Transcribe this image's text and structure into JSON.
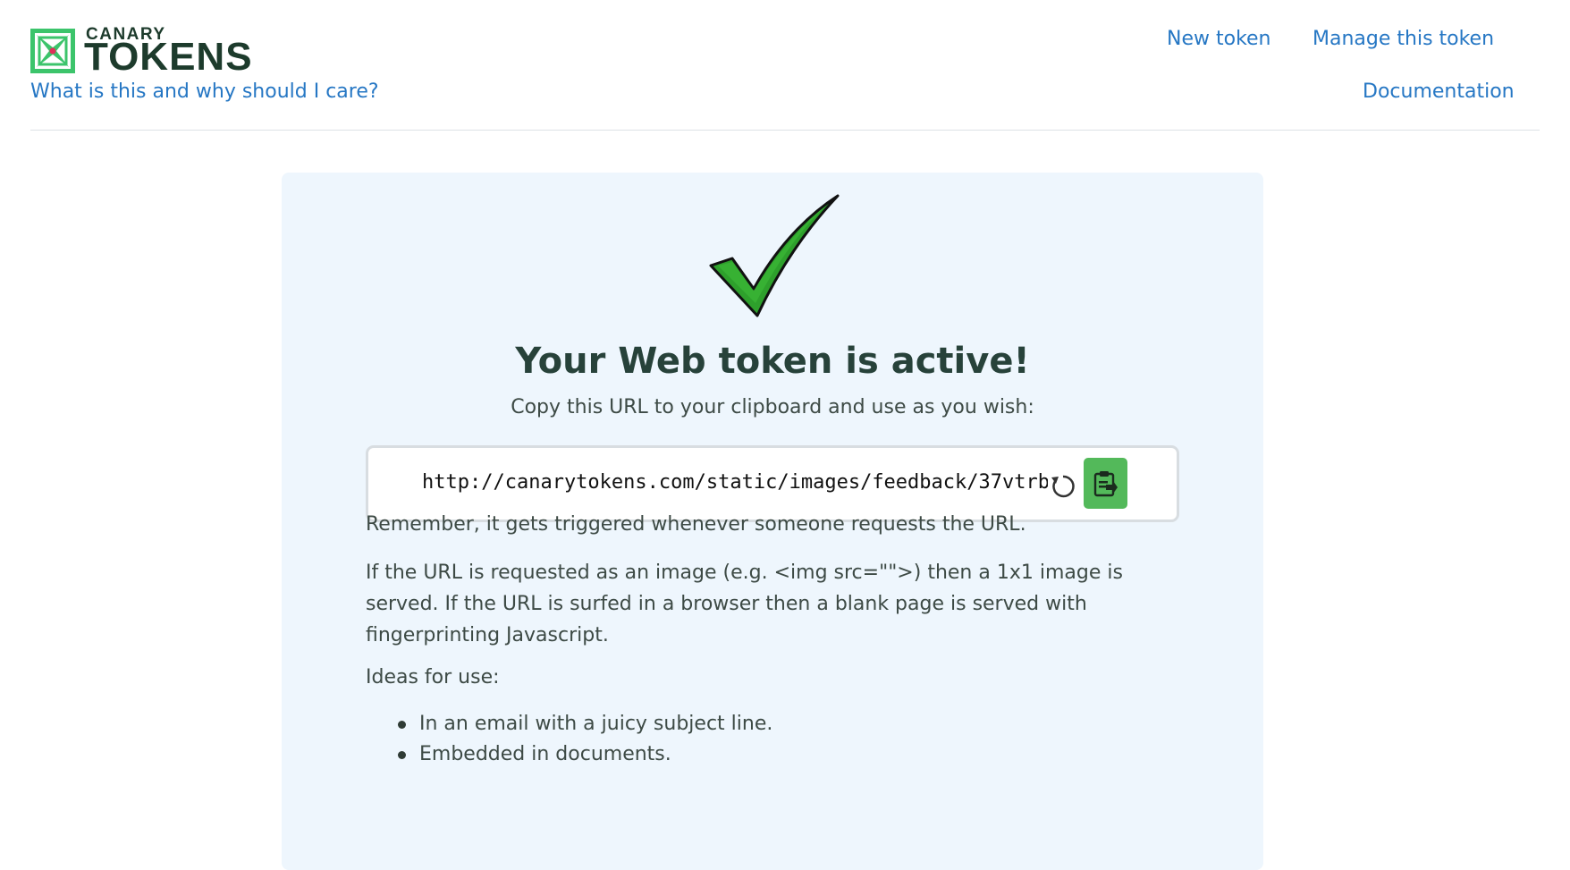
{
  "brand": {
    "small": "CANARY",
    "big": "TOKENS",
    "accent_color": "#3cc46b",
    "dark_color": "#1d3b2c"
  },
  "nav": {
    "what_is_this": "What is this and why should I care?",
    "new_token": "New token",
    "manage_token": "Manage this token",
    "documentation": "Documentation",
    "link_color": "#2677c4"
  },
  "card": {
    "title": "Your Web token is active!",
    "subtitle": "Copy this URL to your clipboard and use as you wish:",
    "url": "http://canarytokens.com/static/images/feedback/37vtrb",
    "refresh_icon": "refresh-icon",
    "copy_icon": "clipboard-icon",
    "copy_button_color": "#53b95a",
    "background_color": "#eef6fd",
    "remember": "Remember, it gets triggered whenever someone requests the URL.",
    "explanation": "If the URL is requested as an image (e.g. <img src=\"\">) then a 1x1 image is served. If the URL is surfed in a browser then a blank page is served with fingerprinting Javascript.",
    "ideas_heading": "Ideas for use:",
    "ideas": [
      "In an email with a juicy subject line.",
      "Embedded in documents."
    ]
  }
}
